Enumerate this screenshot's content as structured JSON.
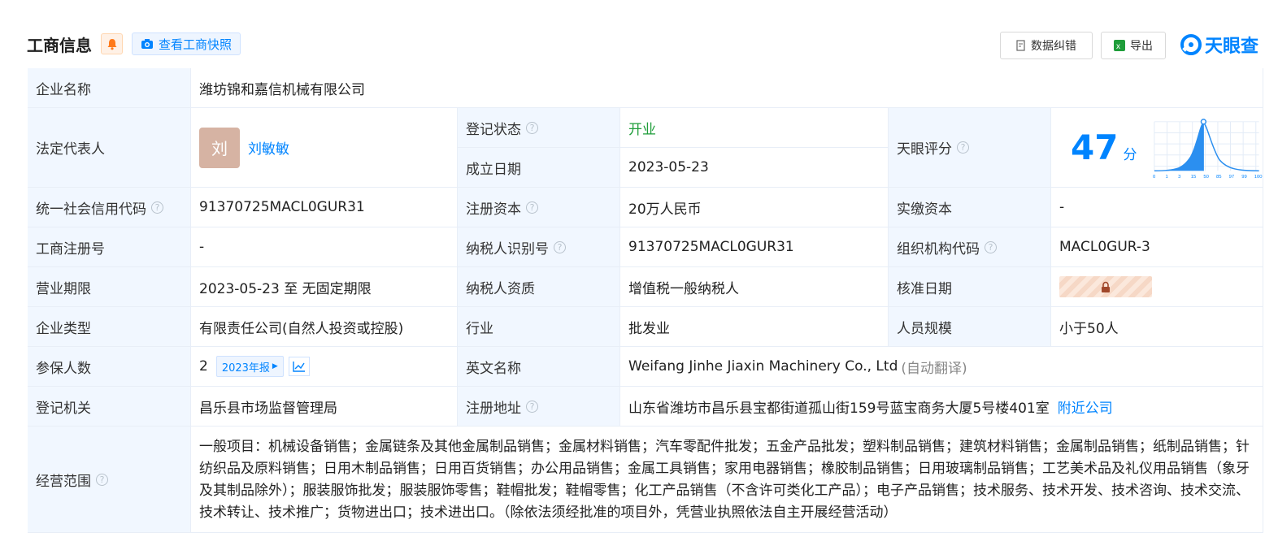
{
  "header": {
    "title": "工商信息",
    "snapshot_label": "查看工商快照",
    "correct_label": "数据纠错",
    "export_label": "导出",
    "logo_text": "天眼查"
  },
  "rows": {
    "company_name_label": "企业名称",
    "company_name": "潍坊锦和嘉信机械有限公司",
    "legal_rep_label": "法定代表人",
    "legal_rep_avatar": "刘",
    "legal_rep_name": "刘敏敏",
    "reg_status_label": "登记状态",
    "reg_status": "开业",
    "found_date_label": "成立日期",
    "found_date": "2023-05-23",
    "tianyan_score_label": "天眼评分",
    "tianyan_score": "47",
    "score_unit": "分",
    "score_ticks": [
      "0",
      "1",
      "3",
      "15",
      "50",
      "85",
      "97",
      "99",
      "100"
    ],
    "credit_code_label": "统一社会信用代码",
    "credit_code": "91370725MACL0GUR31",
    "reg_capital_label": "注册资本",
    "reg_capital": "20万人民币",
    "paid_capital_label": "实缴资本",
    "paid_capital": "-",
    "biz_reg_no_label": "工商注册号",
    "biz_reg_no": "-",
    "taxpayer_id_label": "纳税人识别号",
    "taxpayer_id": "91370725MACL0GUR31",
    "org_code_label": "组织机构代码",
    "org_code": "MACL0GUR-3",
    "biz_term_label": "营业期限",
    "biz_term": "2023-05-23 至 无固定期限",
    "taxpayer_qual_label": "纳税人资质",
    "taxpayer_qual": "增值税一般纳税人",
    "approve_date_label": "核准日期",
    "company_type_label": "企业类型",
    "company_type": "有限责任公司(自然人投资或控股)",
    "industry_label": "行业",
    "industry": "批发业",
    "staff_size_label": "人员规模",
    "staff_size": "小于50人",
    "insured_label": "参保人数",
    "insured": "2",
    "annual_report": "2023年报",
    "english_name_label": "英文名称",
    "english_name": "Weifang Jinhe Jiaxin Machinery Co., Ltd",
    "auto_translate": "(自动翻译)",
    "reg_authority_label": "登记机关",
    "reg_authority": "昌乐县市场监督管理局",
    "reg_address_label": "注册地址",
    "reg_address": "山东省潍坊市昌乐县宝都街道孤山街159号蓝宝商务大厦5号楼401室",
    "nearby_link": "附近公司",
    "scope_label": "经营范围",
    "scope": "一般项目：机械设备销售；金属链条及其他金属制品销售；金属材料销售；汽车零配件批发；五金产品批发；塑料制品销售；建筑材料销售；金属制品销售；纸制品销售；针纺织品及原料销售；日用木制品销售；日用百货销售；办公用品销售；金属工具销售；家用电器销售；橡胶制品销售；日用玻璃制品销售；工艺美术品及礼仪用品销售（象牙及其制品除外）；服装服饰批发；服装服饰零售；鞋帽批发；鞋帽零售；化工产品销售（不含许可类化工产品）；电子产品销售；技术服务、技术开发、技术咨询、技术交流、技术转让、技术推广；货物进出口；技术进出口。（除依法须经批准的项目外，凭营业执照依法自主开展经营活动）"
  },
  "colors": {
    "accent": "#0084ff",
    "label_bg": "#f1f7ff",
    "status_green": "#1f9d3a"
  }
}
